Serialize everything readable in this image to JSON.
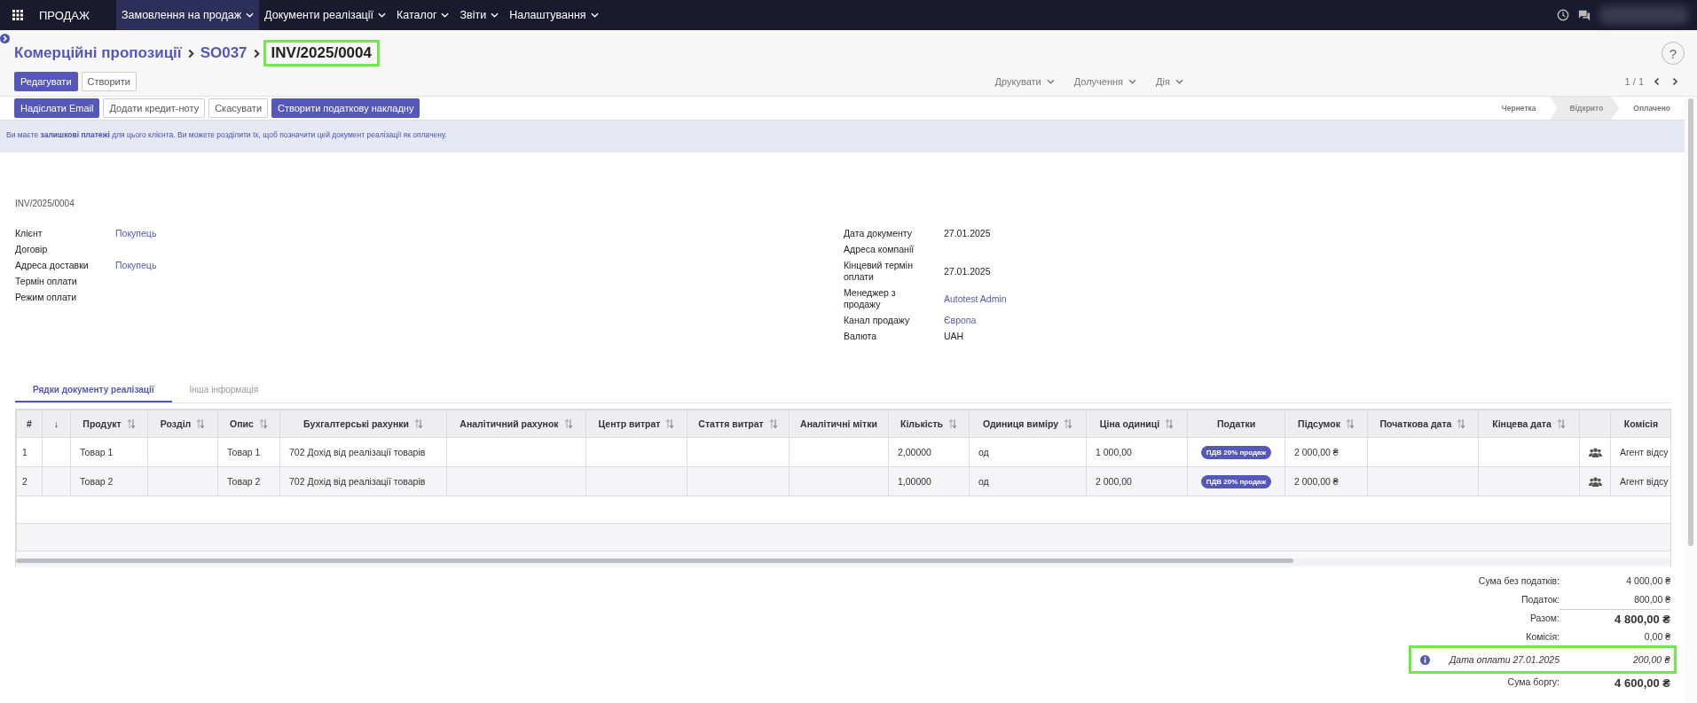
{
  "navbar": {
    "app_name": "ПРОДАЖ",
    "menus": [
      {
        "label": "Замовлення на продаж",
        "selected": true
      },
      {
        "label": "Документи реалізації",
        "selected": false
      },
      {
        "label": "Каталог",
        "selected": false
      },
      {
        "label": "Звіти",
        "selected": false
      },
      {
        "label": "Налаштування",
        "selected": false
      }
    ]
  },
  "breadcrumb": [
    {
      "label": "Комерційні пропозиції",
      "kind": "link"
    },
    {
      "label": "SO037",
      "kind": "link"
    },
    {
      "label": "INV/2025/0004",
      "kind": "current",
      "highlighted": true
    }
  ],
  "control_buttons": [
    {
      "label": "Редагувати",
      "primary": true
    },
    {
      "label": "Створити",
      "primary": false
    }
  ],
  "dropdowns": [
    "Друкувати",
    "Долучення",
    "Дія"
  ],
  "pager": "1 / 1",
  "help_button": "?",
  "action_buttons": [
    {
      "label": "Надіслати Email",
      "primary": true
    },
    {
      "label": "Додати кредит-ноту",
      "primary": false
    },
    {
      "label": "Скасувати",
      "primary": false
    },
    {
      "label": "Створити податкову накладну",
      "primary": true
    }
  ],
  "statusbar": [
    {
      "label": "Чернетка",
      "selected": false
    },
    {
      "label": "Відкрито",
      "selected": true
    },
    {
      "label": "Оплачено",
      "selected": false
    }
  ],
  "alert": "Ви маєте **залишкові платежі** для цього клієнта. Ви можете розділити їх, щоб позначити цей документ реалізації як оплачену.",
  "document_name": "INV/2025/0004",
  "left_fields": [
    {
      "label": "Клієнт",
      "value": "Покупець",
      "kind": "link"
    },
    {
      "label": "Договір"
    },
    {
      "label": "Адреса доставки",
      "value": "Покупець",
      "kind": "link"
    },
    {
      "label": "Термін оплати"
    },
    {
      "label": "Режим оплати"
    }
  ],
  "right_fields": [
    {
      "label": "Дата документу",
      "value": "27.01.2025",
      "kind": "text"
    },
    {
      "label": "Адреса компанії"
    },
    {
      "label": "Кінцевий термін оплати",
      "value": "27.01.2025",
      "kind": "text"
    },
    {
      "label": "Менеджер з продажу",
      "value": "Autotest Admin",
      "kind": "link"
    },
    {
      "label": "Канал продажу",
      "value": "Європа",
      "kind": "link"
    },
    {
      "label": "Валюта",
      "value": "UAH",
      "kind": "text"
    }
  ],
  "tabs": [
    {
      "label": "Рядки документу реалізації",
      "selected": true
    },
    {
      "label": "Інша інформація",
      "selected": false
    }
  ],
  "table": {
    "columns": [
      {
        "label": "#",
        "sortable": false,
        "kind": "text"
      },
      {
        "label": "↓",
        "sortable": false,
        "kind": "text"
      },
      {
        "label": "Продукт",
        "sortable": true,
        "kind": "text"
      },
      {
        "label": "Розділ",
        "sortable": true,
        "kind": "text"
      },
      {
        "label": "Опис",
        "sortable": true,
        "kind": "text"
      },
      {
        "label": "Бухгалтерські рахунки",
        "sortable": true,
        "kind": "text"
      },
      {
        "label": "Аналітичний рахунок",
        "sortable": true,
        "kind": "text"
      },
      {
        "label": "Центр витрат",
        "sortable": true,
        "kind": "text"
      },
      {
        "label": "Стаття витрат",
        "sortable": true,
        "kind": "text"
      },
      {
        "label": "Аналітичні мітки",
        "sortable": false,
        "kind": "text"
      },
      {
        "label": "Кількість",
        "sortable": true,
        "kind": "text"
      },
      {
        "label": "Одиниця виміру",
        "sortable": true,
        "kind": "text"
      },
      {
        "label": "Ціна одиниці",
        "sortable": true,
        "kind": "text"
      },
      {
        "label": "Податки",
        "sortable": false,
        "kind": "tags"
      },
      {
        "label": "Підсумок",
        "sortable": true,
        "kind": "text"
      },
      {
        "label": "Початкова дата",
        "sortable": true,
        "kind": "text"
      },
      {
        "label": "Кінцева дата",
        "sortable": true,
        "kind": "text"
      },
      {
        "kind": "icon"
      },
      {
        "label": "Комісія",
        "sortable": false,
        "kind": "text"
      }
    ],
    "rows": [
      {
        "cells": [
          "1",
          null,
          "Товар 1",
          null,
          "Товар 1",
          "702 Дохід від реалізації товарів",
          null,
          null,
          null,
          null,
          "2,00000",
          "од",
          "1 000,00",
          [
            "ПДВ 20% продаж"
          ],
          "2 000,00 ₴",
          null,
          null,
          null,
          "Агент відсу"
        ]
      },
      {
        "cells": [
          "2",
          null,
          "Товар 2",
          null,
          "Товар 2",
          "702 Дохід від реалізації товарів",
          null,
          null,
          null,
          null,
          "1,00000",
          "од",
          "2 000,00",
          [
            "ПДВ 20% продаж"
          ],
          "2 000,00 ₴",
          null,
          null,
          null,
          "Агент відсу"
        ]
      }
    ]
  },
  "totals": [
    {
      "label": "Сума без податків:",
      "value": "4 000,00 ₴",
      "kind": "plain"
    },
    {
      "label": "Податок:",
      "value": "800,00 ₴",
      "kind": "plain"
    },
    {
      "label": "Разом:",
      "value": "4 800,00 ₴",
      "kind": "total"
    },
    {
      "label": "Комісія:",
      "value": "0,00 ₴",
      "kind": "plain"
    },
    {
      "label": "Дата оплати 27.01.2025",
      "value": "200,00 ₴",
      "kind": "payment",
      "highlighted": true
    },
    {
      "label": "Сума боргу:",
      "value": "4 600,00 ₴",
      "kind": "total"
    }
  ]
}
